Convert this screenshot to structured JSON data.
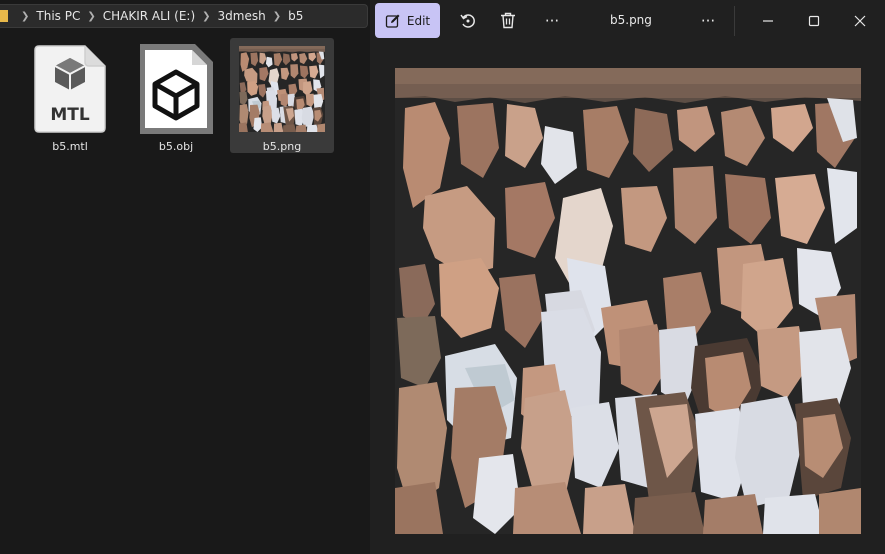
{
  "explorer": {
    "breadcrumb": [
      "This PC",
      "CHAKIR ALI (E:)",
      "3dmesh",
      "b5"
    ],
    "files": [
      {
        "name": "b5.mtl",
        "icon": "mtl-file-icon",
        "badge": "MTL"
      },
      {
        "name": "b5.obj",
        "icon": "obj-file-icon"
      },
      {
        "name": "b5.png",
        "icon": "png-thumbnail"
      }
    ]
  },
  "viewer": {
    "title": "b5.png",
    "edit_label": "Edit",
    "more_label": "···",
    "icons": [
      "edit-icon",
      "rotate-icon",
      "delete-icon",
      "more-icon",
      "minimize-icon",
      "maximize-icon",
      "close-icon"
    ]
  },
  "colors": {
    "accent": "#c8c4f5",
    "folder": "#e8b84a",
    "background": "#202020"
  }
}
